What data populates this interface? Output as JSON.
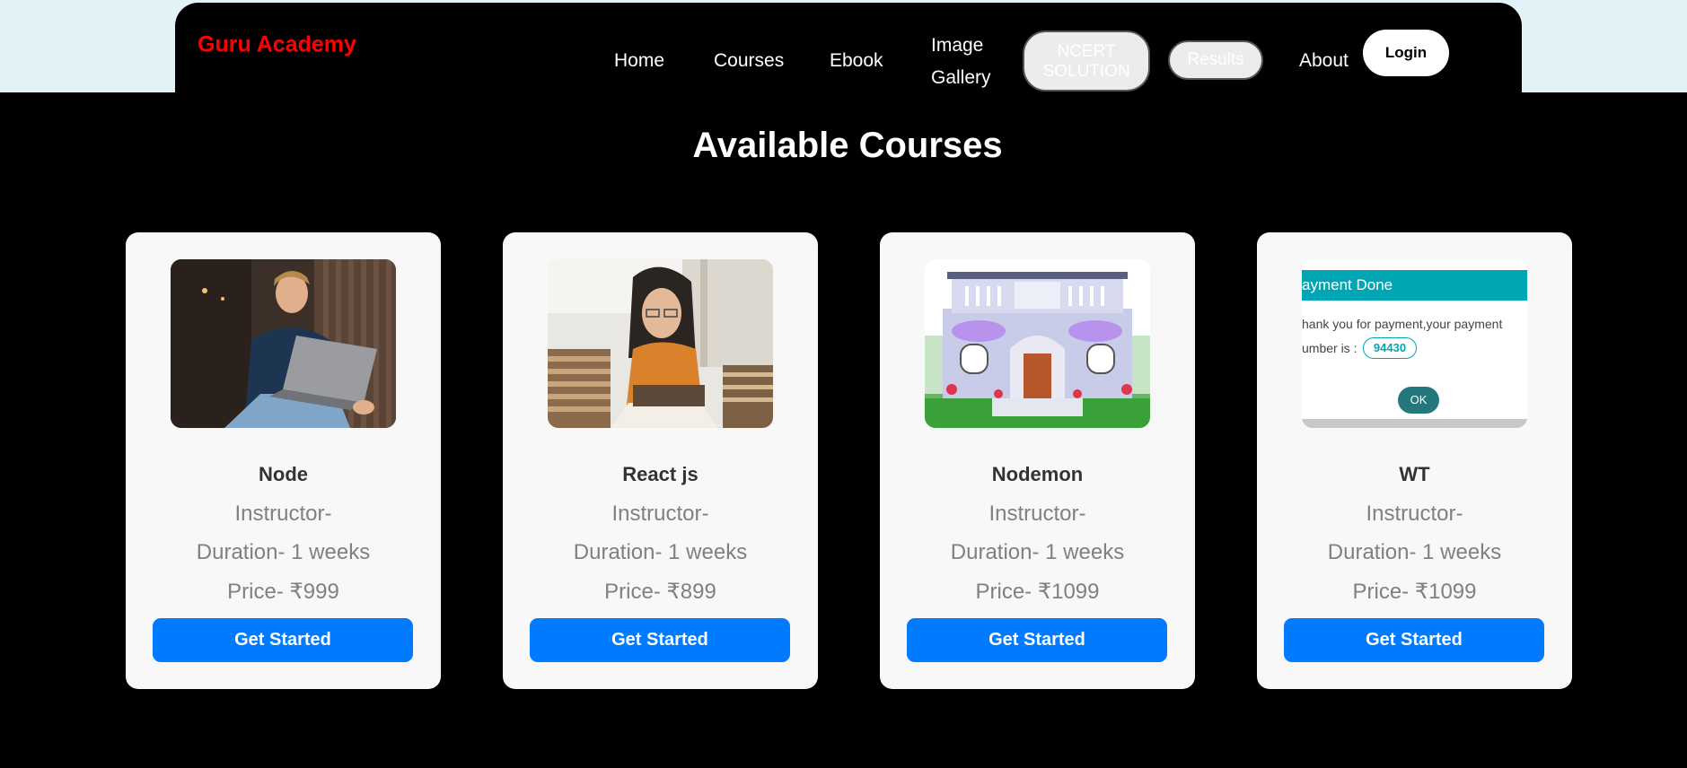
{
  "nav": {
    "brand": "Guru Academy",
    "home": "Home",
    "courses": "Courses",
    "ebook": "Ebook",
    "image": "Image",
    "gallery": "Gallery",
    "ncert_line1": "NCERT",
    "ncert_line2": "SOLUTION",
    "results": "Results",
    "about": "About",
    "login": "Login"
  },
  "page": {
    "heading": "Available Courses"
  },
  "courses": [
    {
      "title": "Node",
      "instructor": "Instructor-",
      "duration": "Duration- 1 weeks",
      "price": "Price- ₹999",
      "button": "Get Started"
    },
    {
      "title": "React js",
      "instructor": "Instructor-",
      "duration": "Duration- 1 weeks",
      "price": "Price- ₹899",
      "button": "Get Started"
    },
    {
      "title": "Nodemon",
      "instructor": "Instructor-",
      "duration": "Duration- 1 weeks",
      "price": "Price- ₹1099",
      "button": "Get Started"
    },
    {
      "title": "WT",
      "instructor": "Instructor-",
      "duration": "Duration- 1 weeks",
      "price": "Price- ₹1099",
      "button": "Get Started"
    }
  ],
  "payment_image": {
    "header": "ayment Done",
    "line1": "hank you for payment,your payment",
    "line2": "umber is :",
    "number": "94430",
    "ok": "OK"
  },
  "colors": {
    "brand": "#ff0000",
    "button": "#007bff",
    "accent": "#00a6b4"
  }
}
